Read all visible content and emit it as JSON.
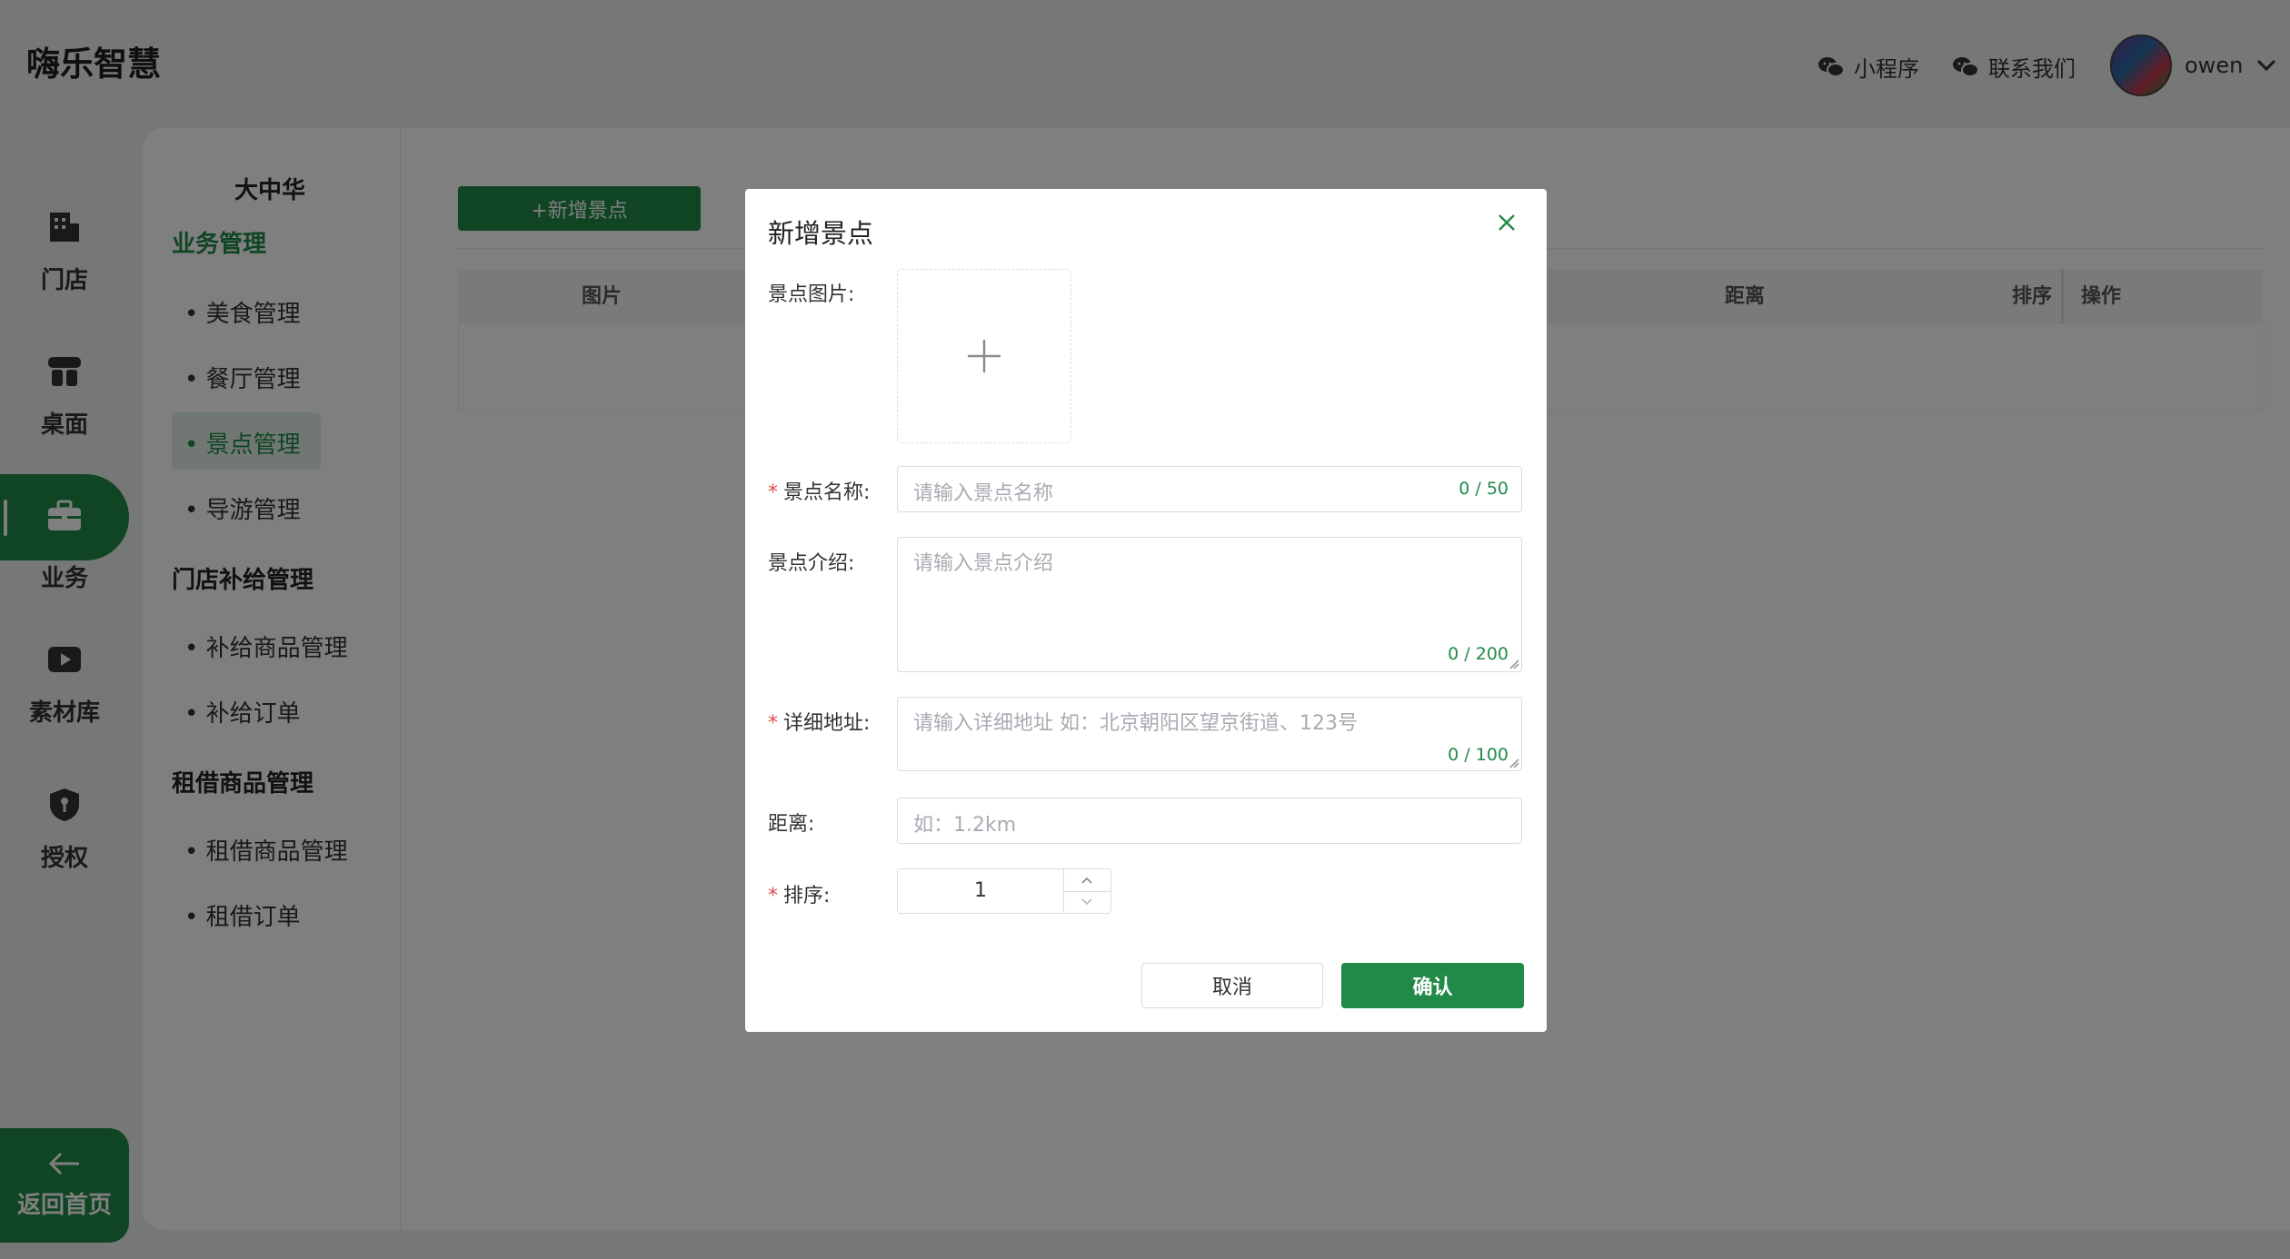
{
  "header": {
    "app_title": "嗨乐智慧",
    "mini_program": "小程序",
    "contact_us": "联系我们",
    "username": "owen"
  },
  "rail": {
    "items": [
      {
        "label": "门店",
        "icon": "store-building-icon"
      },
      {
        "label": "桌面",
        "icon": "table-icon"
      },
      {
        "label": "业务",
        "icon": "briefcase-icon"
      },
      {
        "label": "素材库",
        "icon": "media-library-icon"
      },
      {
        "label": "授权",
        "icon": "shield-key-icon"
      }
    ],
    "active_index": 2,
    "back_home": "返回首页"
  },
  "submenu": {
    "store_name": "大中华",
    "groups": [
      {
        "title": "业务管理",
        "items": [
          "美食管理",
          "餐厅管理",
          "景点管理",
          "导游管理"
        ]
      },
      {
        "title": "门店补给管理",
        "items": [
          "补给商品管理",
          "补给订单"
        ]
      },
      {
        "title": "租借商品管理",
        "items": [
          "租借商品管理",
          "租借订单"
        ]
      }
    ],
    "active_item": "景点管理"
  },
  "main": {
    "add_button": "+新增景点",
    "table_headers": {
      "image": "图片",
      "distance": "距离",
      "sort": "排序",
      "actions": "操作"
    }
  },
  "dialog": {
    "title": "新增景点",
    "image_label": "景点图片:",
    "name_label": "景点名称:",
    "name_placeholder": "请输入景点名称",
    "name_count": "0 / 50",
    "intro_label": "景点介绍:",
    "intro_placeholder": "请输入景点介绍",
    "intro_count": "0 / 200",
    "address_label": "详细地址:",
    "address_placeholder": "请输入详细地址 如：北京朝阳区望京街道、123号",
    "address_count": "0 / 100",
    "distance_label": "距离:",
    "distance_placeholder": "如：1.2km",
    "sort_label": "排序:",
    "sort_value": "1",
    "required_mark": "*",
    "cancel": "取消",
    "confirm": "确认"
  },
  "colors": {
    "brand": "#218a49",
    "required": "#e34d4d"
  }
}
